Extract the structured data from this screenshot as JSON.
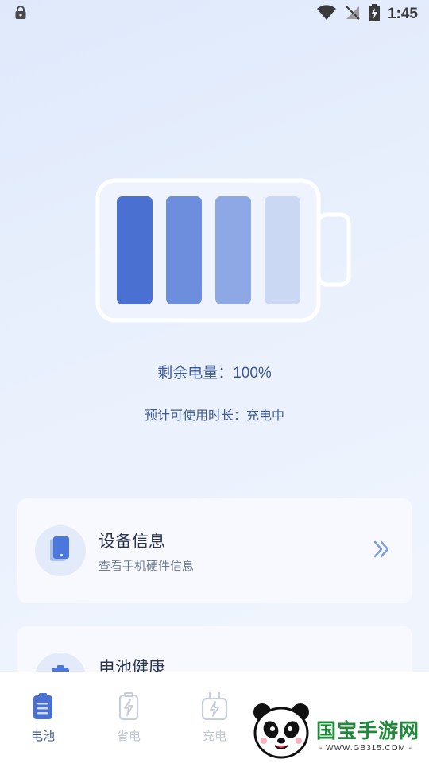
{
  "status_bar": {
    "time": "1:45"
  },
  "battery": {
    "levels": [
      1.0,
      1.0,
      1.0,
      1.0
    ],
    "segment_colors": [
      "#4a70d2",
      "#6d8edc",
      "#8ea8e6",
      "#cbd8f4"
    ]
  },
  "info": {
    "remaining_label": "剩余电量：",
    "remaining_value": "100%",
    "estimate_text": "预计可使用时长：充电中"
  },
  "cards": {
    "device": {
      "title": "设备信息",
      "subtitle": "查看手机硬件信息"
    },
    "health": {
      "title": "电池健康"
    }
  },
  "tabs": [
    {
      "label": "电池",
      "icon": "battery-icon",
      "active": true
    },
    {
      "label": "省电",
      "icon": "power-save-icon",
      "active": false
    },
    {
      "label": "充电",
      "icon": "charger-icon",
      "active": false
    }
  ],
  "watermark": {
    "brand": "国宝手游网",
    "url": "- WWW.GB315.COM -"
  },
  "colors": {
    "accent": "#4a70d2",
    "text_blue": "#3d5a96",
    "brand_green": "#1f8a3a"
  }
}
